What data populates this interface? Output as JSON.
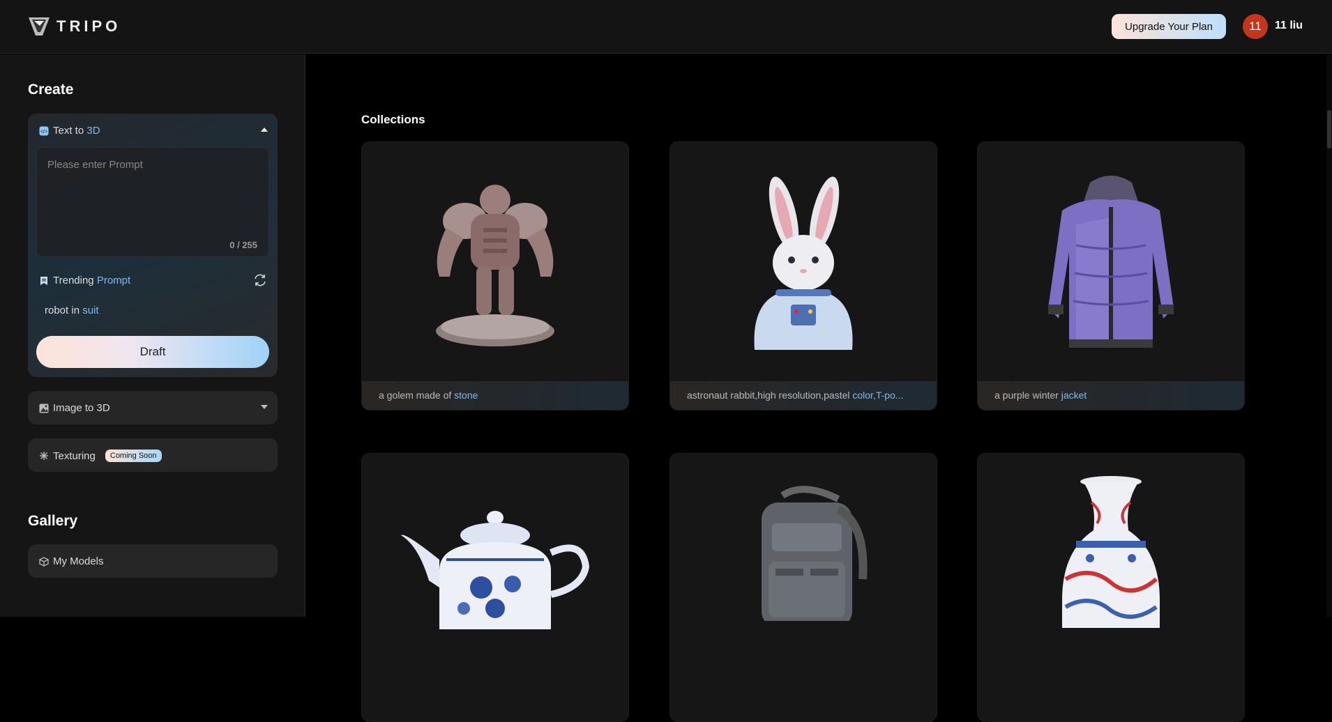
{
  "header": {
    "logo_text": "TRIPO",
    "upgrade_label": "Upgrade Your Plan",
    "avatar_text": "11",
    "username": "11 liu"
  },
  "sidebar": {
    "create_title": "Create",
    "text_to_3d": {
      "prefix": "Text to ",
      "accent": "3D"
    },
    "prompt_placeholder": "Please enter Prompt",
    "prompt_value": "",
    "counter": "0 / 255",
    "trending": {
      "prefix": "Trending ",
      "accent": "Prompt"
    },
    "suggestion": {
      "prefix": "robot in ",
      "accent": "suit"
    },
    "draft_label": "Draft",
    "image_to_3d": "Image to 3D",
    "texturing": "Texturing",
    "coming_soon": "Coming Soon",
    "gallery_title": "Gallery",
    "my_models": "My Models"
  },
  "main": {
    "collections_title": "Collections",
    "cards": [
      {
        "prefix": "a golem made of ",
        "accent": "stone",
        "icon": "golem-model"
      },
      {
        "prefix": "astronaut rabbit,high resolution,pastel ",
        "accent": "color,T-po...",
        "icon": "astronaut-rabbit-model"
      },
      {
        "prefix": "a purple winter ",
        "accent": "jacket",
        "icon": "purple-jacket-model"
      },
      {
        "prefix": "",
        "accent": "",
        "icon": "teapot-model"
      },
      {
        "prefix": "",
        "accent": "",
        "icon": "backpack-model"
      },
      {
        "prefix": "",
        "accent": "",
        "icon": "vase-model"
      }
    ]
  },
  "colors": {
    "accent": "#7dbbf0",
    "avatar": "#c4361c",
    "background": "#000000",
    "sidebar": "#151515"
  }
}
